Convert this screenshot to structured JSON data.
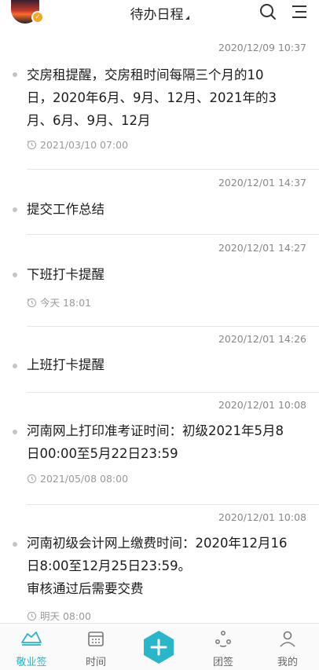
{
  "header": {
    "title": "待办日程",
    "avatar_badge": "✓",
    "icons": [
      "search-icon",
      "menu-icon"
    ]
  },
  "items": [
    {
      "timestamp": "2020/12/09 10:37",
      "text_lines": [
        "交房租提醒，交房租时间每隔三个月的10",
        "日，2020年6月、9月、12月、2021年的3",
        "月、6月、9月、12月"
      ],
      "remind": "2021/03/10 07:00",
      "remind_icon": "repeat-clock-icon"
    },
    {
      "timestamp": "2020/12/01 14:37",
      "text_lines": [
        "提交工作总结"
      ]
    },
    {
      "timestamp": "2020/12/01 14:27",
      "text_lines": [
        "下班打卡提醒"
      ],
      "remind": "今天 18:01",
      "remind_icon": "repeat-clock-icon"
    },
    {
      "timestamp": "2020/12/01 14:26",
      "text_lines": [
        "上班打卡提醒"
      ]
    },
    {
      "timestamp": "2020/12/01 10:08",
      "text_lines": [
        "河南网上打印准考证时间：初级2021年5月8",
        "日00:00至5月22日23:59"
      ],
      "remind": "2021/05/08 08:00",
      "remind_icon": "clock-icon"
    },
    {
      "timestamp": "2020/12/01 10:08",
      "text_lines": [
        "河南初级会计网上缴费时间：2020年12月16",
        "日8:00至12月25日23:59。",
        "审核通过后需要交费"
      ],
      "remind": "明天 08:00",
      "remind_icon": "clock-icon"
    }
  ],
  "tabbar": {
    "tabs": [
      {
        "label": "敬业签",
        "icon": "note-icon",
        "active": true
      },
      {
        "label": "时间",
        "icon": "calendar-icon",
        "active": false
      },
      {
        "label": "团签",
        "icon": "team-icon",
        "active": false
      },
      {
        "label": "我的",
        "icon": "profile-icon",
        "active": false
      }
    ],
    "add_icon": "plus-icon",
    "accent_color": "#2bb5c9"
  }
}
